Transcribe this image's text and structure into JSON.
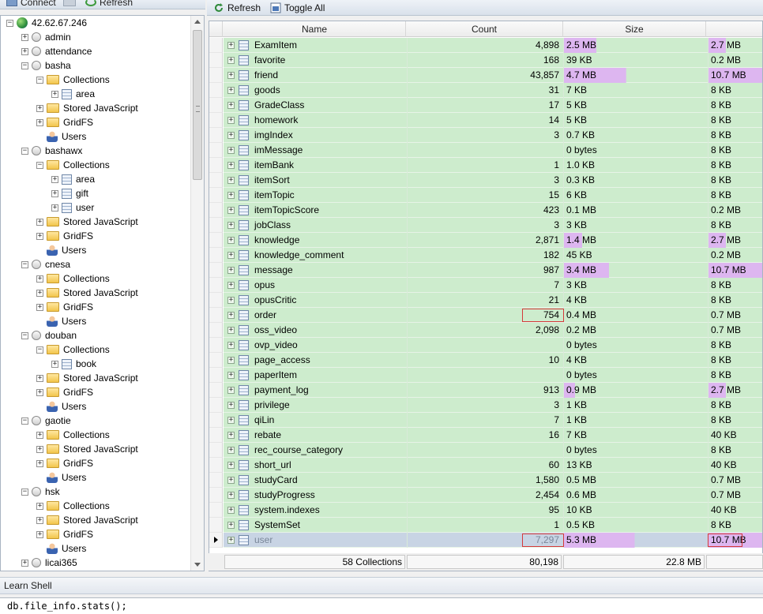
{
  "left_toolbar": {
    "connect_label": "Connect",
    "refresh_label": "Refresh"
  },
  "tree": [
    {
      "level": 0,
      "kind": "server",
      "label": "42.62.67.246",
      "exp": "−"
    },
    {
      "level": 1,
      "kind": "db",
      "label": "admin",
      "exp": "+"
    },
    {
      "level": 1,
      "kind": "db",
      "label": "attendance",
      "exp": "+"
    },
    {
      "level": 1,
      "kind": "db",
      "label": "basha",
      "exp": "−"
    },
    {
      "level": 2,
      "kind": "folder",
      "label": "Collections",
      "exp": "−"
    },
    {
      "level": 3,
      "kind": "table",
      "label": "area",
      "exp": "+"
    },
    {
      "level": 2,
      "kind": "folder",
      "label": "Stored JavaScript",
      "exp": "+"
    },
    {
      "level": 2,
      "kind": "folder",
      "label": "GridFS",
      "exp": "+"
    },
    {
      "level": 2,
      "kind": "user",
      "label": "Users",
      "exp": ""
    },
    {
      "level": 1,
      "kind": "db",
      "label": "bashawx",
      "exp": "−"
    },
    {
      "level": 2,
      "kind": "folder",
      "label": "Collections",
      "exp": "−"
    },
    {
      "level": 3,
      "kind": "table",
      "label": "area",
      "exp": "+"
    },
    {
      "level": 3,
      "kind": "table",
      "label": "gift",
      "exp": "+"
    },
    {
      "level": 3,
      "kind": "table",
      "label": "user",
      "exp": "+"
    },
    {
      "level": 2,
      "kind": "folder",
      "label": "Stored JavaScript",
      "exp": "+"
    },
    {
      "level": 2,
      "kind": "folder",
      "label": "GridFS",
      "exp": "+"
    },
    {
      "level": 2,
      "kind": "user",
      "label": "Users",
      "exp": ""
    },
    {
      "level": 1,
      "kind": "db",
      "label": "cnesa",
      "exp": "−"
    },
    {
      "level": 2,
      "kind": "folder",
      "label": "Collections",
      "exp": "+"
    },
    {
      "level": 2,
      "kind": "folder",
      "label": "Stored JavaScript",
      "exp": "+"
    },
    {
      "level": 2,
      "kind": "folder",
      "label": "GridFS",
      "exp": "+"
    },
    {
      "level": 2,
      "kind": "user",
      "label": "Users",
      "exp": ""
    },
    {
      "level": 1,
      "kind": "db",
      "label": "douban",
      "exp": "−"
    },
    {
      "level": 2,
      "kind": "folder",
      "label": "Collections",
      "exp": "−"
    },
    {
      "level": 3,
      "kind": "table",
      "label": "book",
      "exp": "+"
    },
    {
      "level": 2,
      "kind": "folder",
      "label": "Stored JavaScript",
      "exp": "+"
    },
    {
      "level": 2,
      "kind": "folder",
      "label": "GridFS",
      "exp": "+"
    },
    {
      "level": 2,
      "kind": "user",
      "label": "Users",
      "exp": ""
    },
    {
      "level": 1,
      "kind": "db",
      "label": "gaotie",
      "exp": "−"
    },
    {
      "level": 2,
      "kind": "folder",
      "label": "Collections",
      "exp": "+"
    },
    {
      "level": 2,
      "kind": "folder",
      "label": "Stored JavaScript",
      "exp": "+"
    },
    {
      "level": 2,
      "kind": "folder",
      "label": "GridFS",
      "exp": "+"
    },
    {
      "level": 2,
      "kind": "user",
      "label": "Users",
      "exp": ""
    },
    {
      "level": 1,
      "kind": "db",
      "label": "hsk",
      "exp": "−"
    },
    {
      "level": 2,
      "kind": "folder",
      "label": "Collections",
      "exp": "+"
    },
    {
      "level": 2,
      "kind": "folder",
      "label": "Stored JavaScript",
      "exp": "+"
    },
    {
      "level": 2,
      "kind": "folder",
      "label": "GridFS",
      "exp": "+"
    },
    {
      "level": 2,
      "kind": "user",
      "label": "Users",
      "exp": ""
    },
    {
      "level": 1,
      "kind": "db",
      "label": "licai365",
      "exp": "+"
    }
  ],
  "right_toolbar": {
    "refresh_label": "Refresh",
    "toggle_all_label": "Toggle All"
  },
  "grid": {
    "columns": [
      "Name",
      "Count",
      "Size"
    ],
    "rows": [
      {
        "name": "ExamItem",
        "count": "4,898",
        "size": "2.5 MB",
        "storage": "2.7 MB",
        "size_fill": 0.23,
        "storage_fill": 0.25
      },
      {
        "name": "favorite",
        "count": "168",
        "size": "39 KB",
        "storage": "0.2 MB",
        "size_fill": 0,
        "storage_fill": 0
      },
      {
        "name": "friend",
        "count": "43,857",
        "size": "4.7 MB",
        "storage": "10.7 MB",
        "size_fill": 0.44,
        "storage_fill": 1.0
      },
      {
        "name": "goods",
        "count": "31",
        "size": "7 KB",
        "storage": "8 KB",
        "size_fill": 0,
        "storage_fill": 0
      },
      {
        "name": "GradeClass",
        "count": "17",
        "size": "5 KB",
        "storage": "8 KB",
        "size_fill": 0,
        "storage_fill": 0
      },
      {
        "name": "homework",
        "count": "14",
        "size": "5 KB",
        "storage": "8 KB",
        "size_fill": 0,
        "storage_fill": 0
      },
      {
        "name": "imgIndex",
        "count": "3",
        "size": "0.7 KB",
        "storage": "8 KB",
        "size_fill": 0,
        "storage_fill": 0
      },
      {
        "name": "imMessage",
        "count": "",
        "size": "0 bytes",
        "storage": "8 KB",
        "size_fill": 0,
        "storage_fill": 0
      },
      {
        "name": "itemBank",
        "count": "1",
        "size": "1.0 KB",
        "storage": "8 KB",
        "size_fill": 0,
        "storage_fill": 0
      },
      {
        "name": "itemSort",
        "count": "3",
        "size": "0.3 KB",
        "storage": "8 KB",
        "size_fill": 0,
        "storage_fill": 0
      },
      {
        "name": "itemTopic",
        "count": "15",
        "size": "6 KB",
        "storage": "8 KB",
        "size_fill": 0,
        "storage_fill": 0
      },
      {
        "name": "itemTopicScore",
        "count": "423",
        "size": "0.1 MB",
        "storage": "0.2 MB",
        "size_fill": 0,
        "storage_fill": 0
      },
      {
        "name": "jobClass",
        "count": "3",
        "size": "3 KB",
        "storage": "8 KB",
        "size_fill": 0,
        "storage_fill": 0
      },
      {
        "name": "knowledge",
        "count": "2,871",
        "size": "1.4 MB",
        "storage": "2.7 MB",
        "size_fill": 0.13,
        "storage_fill": 0.25
      },
      {
        "name": "knowledge_comment",
        "count": "182",
        "size": "45 KB",
        "storage": "0.2 MB",
        "size_fill": 0,
        "storage_fill": 0
      },
      {
        "name": "message",
        "count": "987",
        "size": "3.4 MB",
        "storage": "10.7 MB",
        "size_fill": 0.32,
        "storage_fill": 1.0
      },
      {
        "name": "opus",
        "count": "7",
        "size": "3 KB",
        "storage": "8 KB",
        "size_fill": 0,
        "storage_fill": 0
      },
      {
        "name": "opusCritic",
        "count": "21",
        "size": "4 KB",
        "storage": "8 KB",
        "size_fill": 0,
        "storage_fill": 0
      },
      {
        "name": "order",
        "count": "754",
        "size": "0.4 MB",
        "storage": "0.7 MB",
        "size_fill": 0,
        "storage_fill": 0
      },
      {
        "name": "oss_video",
        "count": "2,098",
        "size": "0.2 MB",
        "storage": "0.7 MB",
        "size_fill": 0,
        "storage_fill": 0
      },
      {
        "name": "ovp_video",
        "count": "",
        "size": "0 bytes",
        "storage": "8 KB",
        "size_fill": 0,
        "storage_fill": 0
      },
      {
        "name": "page_access",
        "count": "10",
        "size": "4 KB",
        "storage": "8 KB",
        "size_fill": 0,
        "storage_fill": 0
      },
      {
        "name": "paperItem",
        "count": "",
        "size": "0 bytes",
        "storage": "8 KB",
        "size_fill": 0,
        "storage_fill": 0
      },
      {
        "name": "payment_log",
        "count": "913",
        "size": "0.9 MB",
        "storage": "2.7 MB",
        "size_fill": 0.08,
        "storage_fill": 0.25
      },
      {
        "name": "privilege",
        "count": "3",
        "size": "1 KB",
        "storage": "8 KB",
        "size_fill": 0,
        "storage_fill": 0
      },
      {
        "name": "qiLin",
        "count": "7",
        "size": "1 KB",
        "storage": "8 KB",
        "size_fill": 0,
        "storage_fill": 0
      },
      {
        "name": "rebate",
        "count": "16",
        "size": "7 KB",
        "storage": "40 KB",
        "size_fill": 0,
        "storage_fill": 0
      },
      {
        "name": "rec_course_category",
        "count": "",
        "size": "0 bytes",
        "storage": "8 KB",
        "size_fill": 0,
        "storage_fill": 0
      },
      {
        "name": "short_url",
        "count": "60",
        "size": "13 KB",
        "storage": "40 KB",
        "size_fill": 0,
        "storage_fill": 0
      },
      {
        "name": "studyCard",
        "count": "1,580",
        "size": "0.5 MB",
        "storage": "0.7 MB",
        "size_fill": 0,
        "storage_fill": 0
      },
      {
        "name": "studyProgress",
        "count": "2,454",
        "size": "0.6 MB",
        "storage": "0.7 MB",
        "size_fill": 0,
        "storage_fill": 0
      },
      {
        "name": "system.indexes",
        "count": "95",
        "size": "10 KB",
        "storage": "40 KB",
        "size_fill": 0,
        "storage_fill": 0
      },
      {
        "name": "SystemSet",
        "count": "1",
        "size": "0.5 KB",
        "storage": "8 KB",
        "size_fill": 0,
        "storage_fill": 0
      },
      {
        "name": "user",
        "count": "7,297",
        "size": "5.3 MB",
        "storage": "10.7 MB",
        "size_fill": 0.5,
        "storage_fill": 1.0
      }
    ],
    "highlight_color": "#ddb6f0",
    "selected_row_index": 33,
    "boxed_rows": [
      18,
      33
    ]
  },
  "footer": {
    "collections": "58 Collections",
    "total_count": "80,198",
    "total_size": "22.8 MB"
  },
  "shell": {
    "title": "Learn Shell",
    "command": "db.file_info.stats();"
  }
}
